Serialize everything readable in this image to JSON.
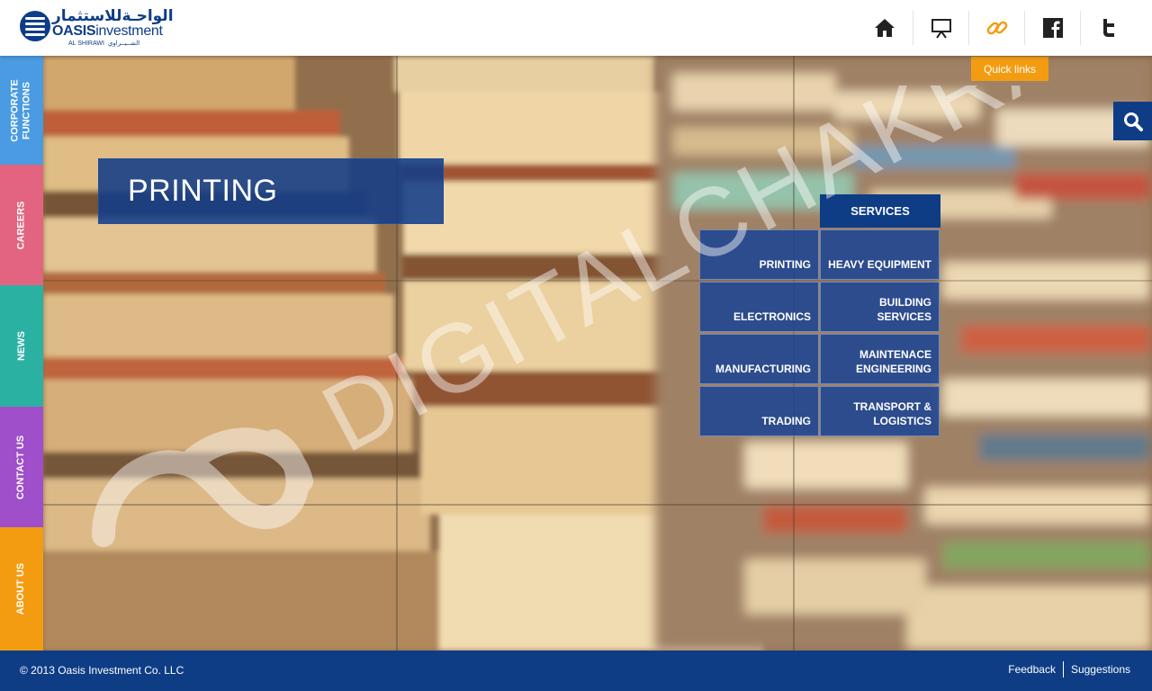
{
  "header": {
    "logo": {
      "arabic": "الواحـةللاستثمار",
      "name_bold": "OASIS",
      "name_rest": "investment",
      "sub_en": "AL SHIRAWI",
      "sub_ar": "الشــيــراوي"
    },
    "icons": [
      {
        "name": "home-icon",
        "color": "#222222"
      },
      {
        "name": "presentation-icon",
        "color": "#222222"
      },
      {
        "name": "link-icon",
        "color": "#f39c12"
      },
      {
        "name": "facebook-icon",
        "color": "#222222"
      },
      {
        "name": "twitter-icon",
        "color": "#222222"
      }
    ]
  },
  "sidebar": {
    "items": [
      {
        "label": "CORPORATE FUNCTIONS",
        "color": "#4a9be2"
      },
      {
        "label": "CAREERS",
        "color": "#e36480"
      },
      {
        "label": "NEWS",
        "color": "#2bb1a2"
      },
      {
        "label": "CONTACT US",
        "color": "#9e4fc9"
      },
      {
        "label": "ABOUT US",
        "color": "#f39c12"
      }
    ]
  },
  "main": {
    "page_title": "PRINTING",
    "quick_links": "Quick links",
    "search_icon": "search-icon",
    "services": {
      "title": "SERVICES",
      "items": [
        "PRINTING",
        "HEAVY EQUIPMENT",
        "ELECTRONICS",
        "BUILDING SERVICES",
        "MANUFACTURING",
        "MAINTENACE ENGINEERING",
        "TRADING",
        "TRANSPORT & LOGISTICS"
      ]
    },
    "watermark": "DIGITALCHAKRA"
  },
  "footer": {
    "copyright": "© 2013 Oasis Investment Co. LLC",
    "links": [
      "Feedback",
      "Suggestions"
    ]
  },
  "colors": {
    "brand": "#0e3d86",
    "accent": "#f39c12"
  }
}
